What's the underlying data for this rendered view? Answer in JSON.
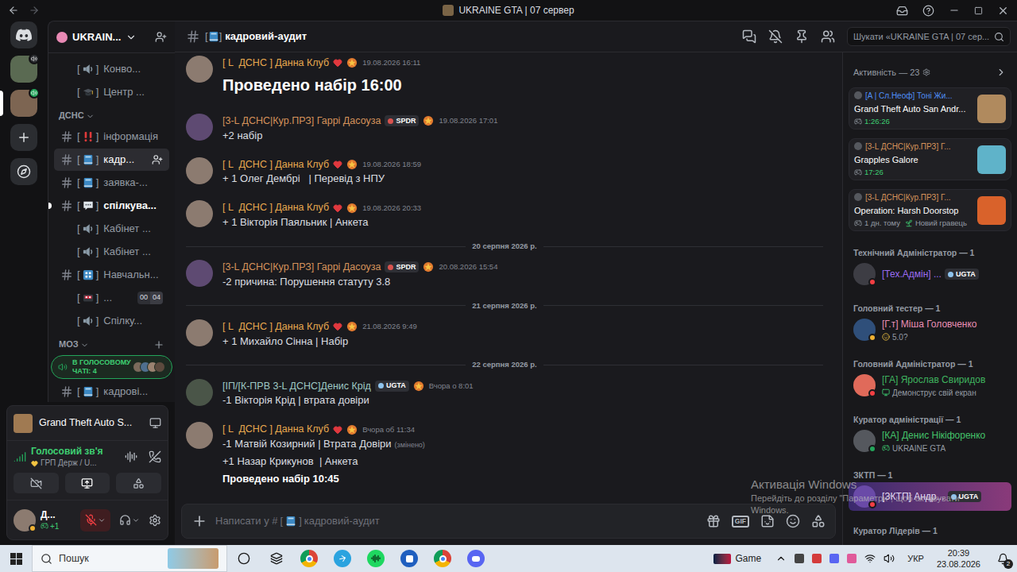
{
  "window": {
    "title": "UKRAINE GTA | 07 сервер"
  },
  "servers": [
    {
      "selected": false,
      "in_voice": true,
      "color": "#2b2d31"
    },
    {
      "selected": true,
      "in_voice": true,
      "color": "#23a55a"
    }
  ],
  "sidebar": {
    "server_name": "UKRAIN...",
    "brackets": [
      "[",
      "]"
    ],
    "items": [
      {
        "kind": "voice",
        "name": "Конво...",
        "selected": false,
        "unread": false
      },
      {
        "kind": "voice",
        "name": "Центр ...",
        "selected": false,
        "unread": false
      },
      {
        "kind": "category",
        "name": "ДСНС",
        "expanded": true,
        "addable": false
      },
      {
        "kind": "text",
        "name": "інформація",
        "selected": false,
        "unread": false
      },
      {
        "kind": "text",
        "name": "кадр...",
        "selected": true,
        "unread": false
      },
      {
        "kind": "text",
        "name": "заявка-...",
        "selected": false,
        "unread": false
      },
      {
        "kind": "text",
        "name": "спілкува...",
        "selected": false,
        "unread": true
      },
      {
        "kind": "voice",
        "name": "Кабінет ...",
        "selected": false,
        "unread": false
      },
      {
        "kind": "voice",
        "name": "Кабінет ...",
        "selected": false,
        "unread": false
      },
      {
        "kind": "text",
        "name": "Навчальн...",
        "selected": false,
        "unread": false
      },
      {
        "kind": "voice",
        "name": "...",
        "selected": false,
        "unread": false,
        "limit": [
          "00",
          "04"
        ]
      },
      {
        "kind": "voice",
        "name": "Спілку...",
        "selected": false,
        "unread": false
      },
      {
        "kind": "category",
        "name": "МОЗ",
        "expanded": true,
        "addable": true
      },
      {
        "kind": "voice-summary",
        "name": "В ГОЛОСОВОМУ ЧАТІ: 4",
        "avatars": [
          "#7b6a5c",
          "#4f6f8f",
          "#9a8270",
          "#5c4a3e"
        ]
      },
      {
        "kind": "text",
        "name": "кадрові...",
        "selected": false,
        "unread": false
      }
    ]
  },
  "user_panel": {
    "activity": "Grand Theft Auto S...",
    "voice_status": "Голосовий зв'я",
    "voice_channel": "ГРП Держ / U...",
    "camera_on": false,
    "screen_sharing": true,
    "user_name": "Д...",
    "user_badge": "+1",
    "mic_muted": true,
    "status": "idle"
  },
  "channel": {
    "name": "кадровий-аудит"
  },
  "search": {
    "placeholder": "Шукати «UKRAINE GTA | 07 сер..."
  },
  "timeline": [
    {
      "kind": "message",
      "author": "[ L  ДСНС ] Данна Клуб",
      "name_color": "#e8a94f",
      "heart": true,
      "avatar_color": "#8c7b70",
      "time": "19.08.2026 16:11",
      "lines": [
        {
          "text": "Проведено набір 16:00",
          "style": "heading"
        }
      ]
    },
    {
      "kind": "message",
      "author": "[3-L ДСНС|Кур.ПРЗ] Гаррі Дасоуза",
      "name_color": "#d6935b",
      "heart": false,
      "tag": "SPDR",
      "tag_color": "#d9534f",
      "avatar_color": "#5e4a72",
      "time": "19.08.2026 17:01",
      "lines": [
        {
          "text": "+2 набір",
          "style": "normal"
        }
      ]
    },
    {
      "kind": "message",
      "author": "[ L  ДСНС ] Данна Клуб",
      "name_color": "#e8a94f",
      "heart": true,
      "avatar_color": "#8c7b70",
      "time": "19.08.2026 18:59",
      "lines": [
        {
          "text": "+ 1 Олег Дембрі   | Перевід з НПУ",
          "style": "normal"
        }
      ]
    },
    {
      "kind": "message",
      "author": "[ L  ДСНС ] Данна Клуб",
      "name_color": "#e8a94f",
      "heart": true,
      "avatar_color": "#8c7b70",
      "time": "19.08.2026 20:33",
      "lines": [
        {
          "text": "+ 1 Вікторія Паяльник | Анкета",
          "style": "normal"
        }
      ]
    },
    {
      "kind": "divider",
      "text": "20 серпня 2026 р."
    },
    {
      "kind": "message",
      "author": "[3-L ДСНС|Кур.ПРЗ] Гаррі Дасоуза",
      "name_color": "#d6935b",
      "heart": false,
      "tag": "SPDR",
      "tag_color": "#d9534f",
      "avatar_color": "#5e4a72",
      "time": "20.08.2026 15:54",
      "lines": [
        {
          "text": "-2 причина: Порушення статуту 3.8",
          "style": "normal"
        }
      ]
    },
    {
      "kind": "divider",
      "text": "21 серпня 2026 р."
    },
    {
      "kind": "message",
      "author": "[ L  ДСНС ] Данна Клуб",
      "name_color": "#e8a94f",
      "heart": true,
      "avatar_color": "#8c7b70",
      "time": "21.08.2026 9:49",
      "lines": [
        {
          "text": "+ 1 Михайло Сінна | Набір",
          "style": "normal"
        }
      ]
    },
    {
      "kind": "divider",
      "text": "22 серпня 2026 р."
    },
    {
      "kind": "message",
      "author": "[ІП/[К-ПРВ 3-L ДСНС]Денис Крід",
      "name_color": "#9ec9c4",
      "heart": false,
      "tag": "UGTA",
      "tag_color": "#8fc4ee",
      "avatar_color": "#4a5548",
      "time": "Вчора о 8:01",
      "lines": [
        {
          "text": "-1 Вікторія Крід | втрата довіри",
          "style": "normal"
        }
      ]
    },
    {
      "kind": "message",
      "author": "[ L  ДСНС ] Данна Клуб",
      "name_color": "#e8a94f",
      "heart": true,
      "avatar_color": "#8c7b70",
      "time": "Вчора об 11:34",
      "lines": [
        {
          "text": "-1 Матвій Козирний | Втрата Довіри",
          "style": "normal",
          "edited": "(змінено)"
        },
        {
          "text": "+1 Назар Крикунов  | Анкета",
          "style": "normal"
        },
        {
          "text": "Проведено набір 10:45",
          "style": "bold"
        }
      ]
    }
  ],
  "composer": {
    "placeholder_prefix": "Написати у #",
    "gif_label": "GIF"
  },
  "members": {
    "activity_title": "Активність — 23",
    "cards": [
      {
        "user": "[A | Сл.Неоф] Тоні Жи...",
        "user_color": "#4f8ff7",
        "game": "Grand Theft Auto San Andr...",
        "detail": "1:26:26",
        "detail_kind": "timer",
        "image_color": "#b08a5e"
      },
      {
        "user": "[3-L ДСНС|Кур.ПРЗ] Г...",
        "user_color": "#d6935b",
        "game": "Grapples Galore",
        "detail": "17:26",
        "detail_kind": "timer",
        "image_color": "#5fb3c9"
      },
      {
        "user": "[3-L ДСНС|Кур.ПРЗ] Г...",
        "user_color": "#d6935b",
        "game": "Operation: Harsh Doorstop",
        "detail": "1 дн. тому",
        "detail_kind": "ago",
        "extra": "Новий гравець",
        "image_color": "#d9622b"
      }
    ],
    "groups": [
      {
        "title": "Технічний Адміністратор — 1",
        "members": [
          {
            "name": "[Тех.Адмін] ...",
            "color": "#9b6cf2",
            "tag": "UGTA",
            "status": "dnd",
            "highlight": false,
            "avatar_color": "#3d3d44"
          }
        ]
      },
      {
        "title": "Головний тестер — 1",
        "members": [
          {
            "name": "[Г.т] Міша Головченко",
            "color": "#ea8fb5",
            "status": "idle",
            "sub": "5.0?",
            "sub_kind": "emoji",
            "highlight": false,
            "avatar_color": "#2f4f7a"
          }
        ]
      },
      {
        "title": "Головний Адміністратор — 1",
        "members": [
          {
            "name": "[ГА] Ярослав Свиридов",
            "color": "#3fb45f",
            "status": "dnd",
            "sub": "Демонструє свій екран",
            "sub_kind": "screen",
            "highlight": false,
            "avatar_color": "#e06a5a"
          }
        ]
      },
      {
        "title": "Куратор адміністрації — 1",
        "members": [
          {
            "name": "[КА] Денис Нікіфоренко",
            "color": "#43c36a",
            "status": "online",
            "sub": "UKRAINE GTA",
            "sub_kind": "game",
            "highlight": false,
            "avatar_color": "#55585e"
          }
        ]
      },
      {
        "title": "ЗКТП — 1",
        "members": [
          {
            "name": "[ЗКТП] Андр...",
            "color": "#e4dcf5",
            "tag": "UGTA",
            "status": "dnd",
            "highlight": true,
            "avatar_color": "#6a4aa8"
          }
        ]
      },
      {
        "title": "Куратор Лідерів — 1",
        "members": []
      }
    ]
  },
  "watermark": {
    "title": "Активація Windows",
    "line": "Перейдіть до розділу \"Параметри\", щоб активувати",
    "line2": "Windows."
  },
  "taskbar": {
    "search": "Пошук",
    "game": "Game",
    "lang": "УКР",
    "time": "20:39",
    "date": "23.08.2026",
    "notifications": "2"
  }
}
